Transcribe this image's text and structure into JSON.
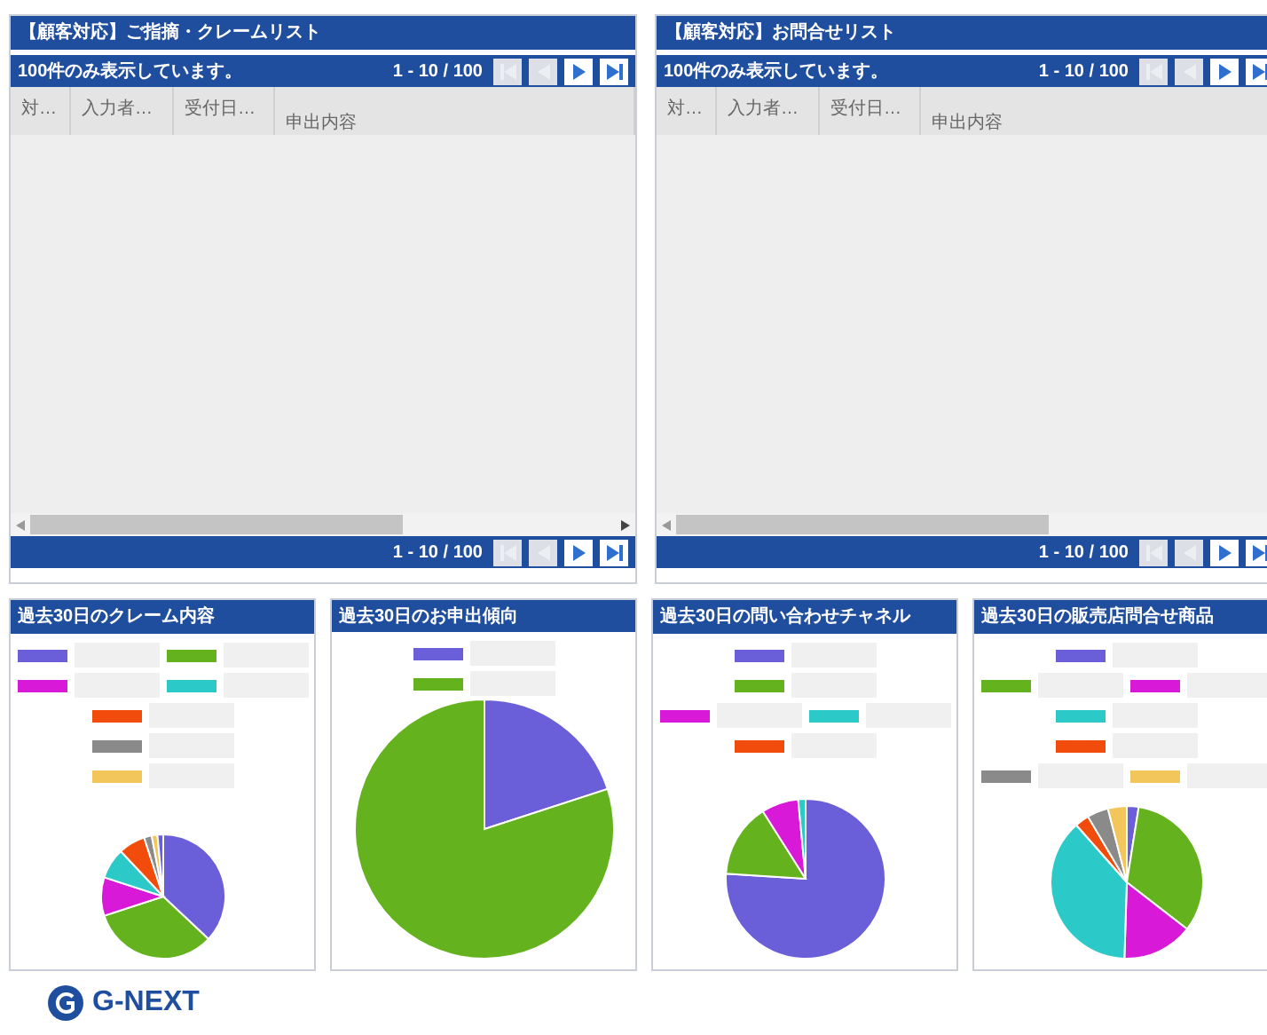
{
  "lists": [
    {
      "title": "【顧客対応】ご指摘・クレームリスト",
      "notice": "100件のみ表示しています。",
      "range_top": "1 - 10 / 100",
      "range_bottom": "1 - 10 / 100",
      "columns": [
        "対…",
        "入力者…",
        "受付日…",
        "申出内容"
      ],
      "pager": [
        {
          "kind": "first",
          "disabled": true
        },
        {
          "kind": "prev",
          "disabled": true
        },
        {
          "kind": "next",
          "disabled": false
        },
        {
          "kind": "last",
          "disabled": false
        }
      ]
    },
    {
      "title": "【顧客対応】お問合せリスト",
      "notice": "100件のみ表示しています。",
      "range_top": "1 - 10 / 100",
      "range_bottom": "1 - 10 / 100",
      "columns": [
        "対…",
        "入力者…",
        "受付日…",
        "申出内容"
      ],
      "pager": [
        {
          "kind": "first",
          "disabled": true
        },
        {
          "kind": "prev",
          "disabled": true
        },
        {
          "kind": "next",
          "disabled": false
        },
        {
          "kind": "last",
          "disabled": false
        }
      ]
    }
  ],
  "charts": [
    {
      "title": "過去30日のクレーム内容",
      "legend_rows": [
        [
          {
            "color": "#6a5fd8"
          },
          {
            "color": "#64b31e"
          }
        ],
        [
          {
            "color": "#d81ad8"
          },
          {
            "color": "#2cc9c9"
          }
        ],
        [
          {
            "color": "#f24c0c"
          }
        ],
        [
          {
            "color": "#8a8a8a"
          }
        ],
        [
          {
            "color": "#f2c65a"
          }
        ]
      ]
    },
    {
      "title": "過去30日のお申出傾向",
      "legend_rows": [
        [
          {
            "color": "#6a5fd8"
          }
        ],
        [
          {
            "color": "#64b31e"
          }
        ]
      ]
    },
    {
      "title": "過去30日の問い合わせチャネル",
      "legend_rows": [
        [
          {
            "color": "#6a5fd8"
          }
        ],
        [
          {
            "color": "#64b31e"
          }
        ],
        [
          {
            "color": "#d81ad8"
          },
          {
            "color": "#2cc9c9"
          }
        ],
        [
          {
            "color": "#f24c0c"
          }
        ]
      ]
    },
    {
      "title": "過去30日の販売店問合せ商品",
      "legend_rows": [
        [
          {
            "color": "#6a5fd8"
          }
        ],
        [
          {
            "color": "#64b31e"
          },
          {
            "color": "#d81ad8"
          }
        ],
        [
          {
            "color": "#2cc9c9"
          }
        ],
        [
          {
            "color": "#f24c0c"
          }
        ],
        [
          {
            "color": "#8a8a8a"
          },
          {
            "color": "#f2c65a"
          }
        ]
      ]
    }
  ],
  "logo": {
    "text": "G-NEXT"
  }
}
